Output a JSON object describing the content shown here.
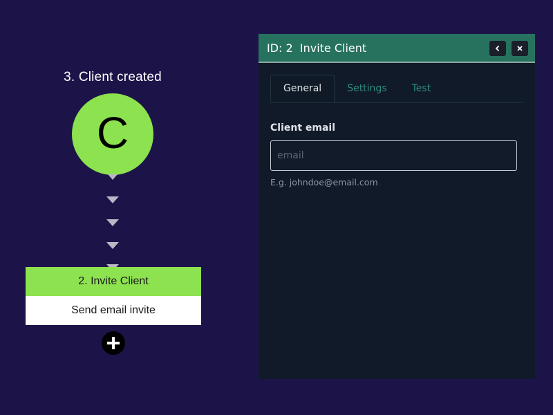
{
  "flow": {
    "trigger": {
      "title": "3. Client created",
      "letter": "C",
      "color": "#8de24f"
    },
    "action": {
      "title": "2. Invite Client",
      "description": "Send email invite",
      "color": "#8de24f"
    },
    "add_step_icon": "plus-icon"
  },
  "panel": {
    "title": "ID: 2  Invite Client",
    "header_color": "#27725f",
    "buttons": {
      "back_icon": "chevron-left-icon",
      "close_icon": "close-icon"
    },
    "tabs": [
      {
        "label": "General",
        "active": true
      },
      {
        "label": "Settings",
        "active": false
      },
      {
        "label": "Test",
        "active": false
      }
    ],
    "form": {
      "email": {
        "label": "Client email",
        "value": "",
        "placeholder": "email",
        "hint": "E.g. johndoe@email.com"
      }
    }
  },
  "colors": {
    "background": "#1c1449",
    "panel_background": "#111a29",
    "tab_accent": "#2e8c82"
  }
}
